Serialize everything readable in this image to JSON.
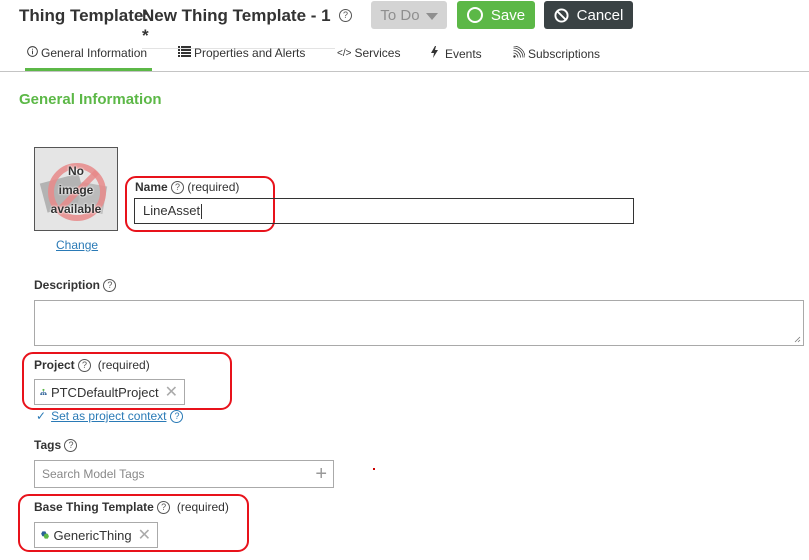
{
  "header": {
    "title_label": "Thing Template:",
    "entity_name": "New Thing Template - 1 *",
    "help_icon": "help-circle-icon",
    "state_dropdown": "To Do",
    "save_label": "Save",
    "cancel_label": "Cancel"
  },
  "tabs": [
    {
      "label": "General Information",
      "icon": "info-circle-icon",
      "active": true
    },
    {
      "label": "Properties and Alerts",
      "icon": "list-icon",
      "active": false
    },
    {
      "label": "Services",
      "icon": "code-icon",
      "active": false
    },
    {
      "label": "Events",
      "icon": "lightning-icon",
      "active": false
    },
    {
      "label": "Subscriptions",
      "icon": "rss-icon",
      "active": false
    }
  ],
  "section": {
    "title": "General Information",
    "image_placeholder": {
      "line1": "No",
      "line2": "image",
      "line3": "available"
    },
    "change_link": "Change",
    "name": {
      "label": "Name",
      "required": "(required)",
      "value": "LineAsset"
    },
    "description": {
      "label": "Description",
      "value": ""
    },
    "project": {
      "label": "Project",
      "required": "(required)",
      "value": "PTCDefaultProject",
      "context_link": "Set as project context"
    },
    "tags": {
      "label": "Tags",
      "placeholder": "Search Model Tags"
    },
    "base_template": {
      "label": "Base Thing Template",
      "required": "(required)",
      "value": "GenericThing"
    }
  },
  "colors": {
    "accent_green": "#5cb847",
    "cancel_dark": "#3a4244",
    "link_blue": "#2a7ab6",
    "highlight_red": "#e8121b"
  }
}
